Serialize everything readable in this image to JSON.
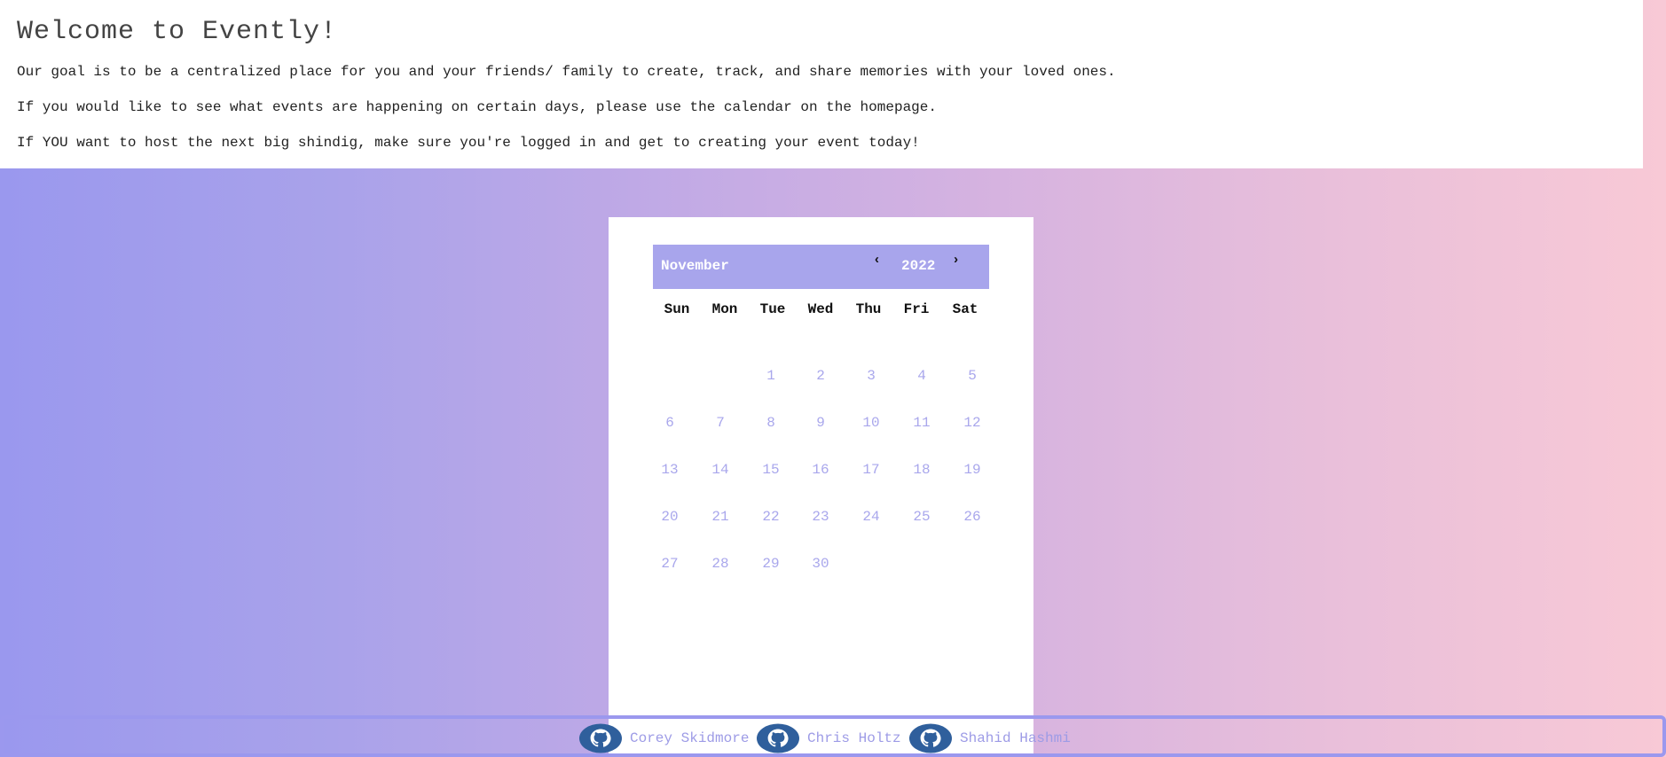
{
  "welcome": {
    "title": "Welcome to Evently!",
    "paragraphs": [
      "Our goal is to be a centralized place for you and your friends/ family to create, track, and share memories with your loved ones.",
      "If you would like to see what events are happening on certain days, please use the calendar on the homepage.",
      "If YOU want to host the next big shindig, make sure you're logged in and get to creating your event today!"
    ]
  },
  "calendar": {
    "month": "November",
    "year": "2022",
    "prev_label": "‹",
    "next_label": "›",
    "weekdays": [
      "Sun",
      "Mon",
      "Tue",
      "Wed",
      "Thu",
      "Fri",
      "Sat"
    ],
    "weeks": [
      [
        "",
        "",
        "1",
        "2",
        "3",
        "4",
        "5"
      ],
      [
        "6",
        "7",
        "8",
        "9",
        "10",
        "11",
        "12"
      ],
      [
        "13",
        "14",
        "15",
        "16",
        "17",
        "18",
        "19"
      ],
      [
        "20",
        "21",
        "22",
        "23",
        "24",
        "25",
        "26"
      ],
      [
        "27",
        "28",
        "29",
        "30",
        "",
        "",
        ""
      ]
    ]
  },
  "footer": {
    "developers": [
      {
        "name": "Corey Skidmore",
        "icon": "github-icon"
      },
      {
        "name": "Chris Holtz",
        "icon": "github-icon"
      },
      {
        "name": "Shahid Hashmi",
        "icon": "github-icon"
      }
    ]
  },
  "colors": {
    "accent": "#a8a5ec",
    "day_text": "#a9a7ec",
    "footer_border": "#9b98ee"
  }
}
